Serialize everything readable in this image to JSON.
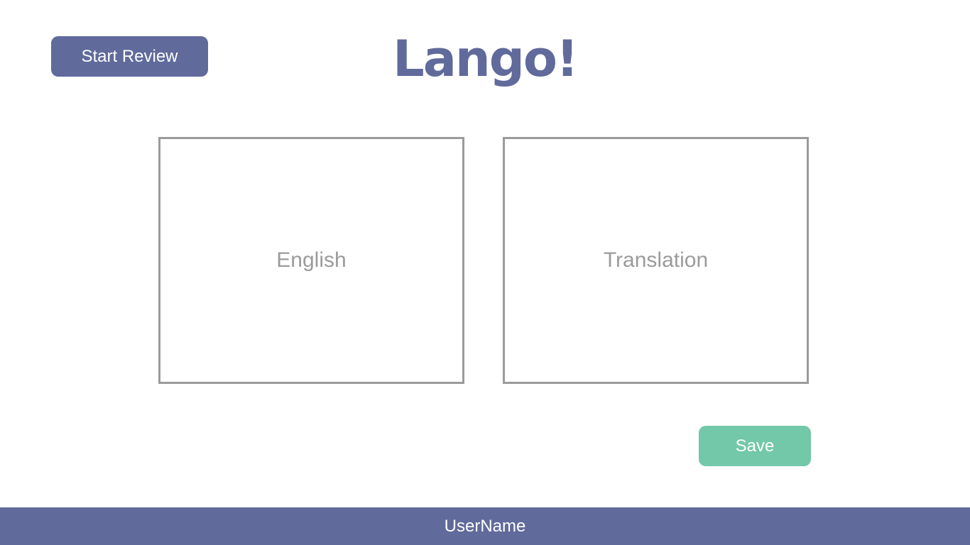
{
  "header": {
    "start_review_label": "Start Review",
    "logo_text": "Lango!"
  },
  "cards": {
    "english": {
      "placeholder": "English"
    },
    "translation": {
      "placeholder": "Translation"
    }
  },
  "actions": {
    "save_label": "Save"
  },
  "footer": {
    "username": "UserName"
  },
  "colors": {
    "primary": "#606a9b",
    "accent": "#72c8a9",
    "border": "#9b9b9b",
    "background": "#ffffff"
  }
}
